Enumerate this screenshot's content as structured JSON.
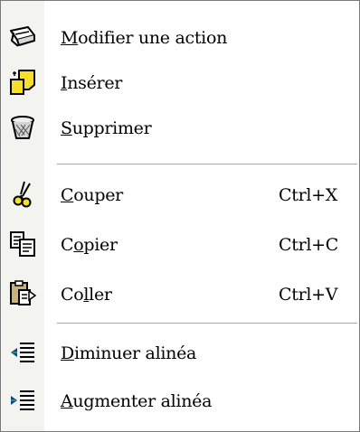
{
  "menu": {
    "items": [
      {
        "pre": "",
        "key": "M",
        "post": "odifier une action",
        "shortcut": "",
        "icon": "edit-action-icon"
      },
      {
        "pre": "",
        "key": "I",
        "post": "nsérer",
        "shortcut": "",
        "icon": "insert-icon"
      },
      {
        "pre": "",
        "key": "S",
        "post": "upprimer",
        "shortcut": "",
        "icon": "trash-icon"
      },
      {
        "pre": "",
        "key": "C",
        "post": "ouper",
        "shortcut": "Ctrl+X",
        "icon": "scissors-icon"
      },
      {
        "pre": "C",
        "key": "o",
        "post": "pier",
        "shortcut": "Ctrl+C",
        "icon": "copy-icon"
      },
      {
        "pre": "Co",
        "key": "l",
        "post": "ler",
        "shortcut": "Ctrl+V",
        "icon": "paste-icon"
      },
      {
        "pre": "",
        "key": "D",
        "post": "iminuer alinéa",
        "shortcut": "",
        "icon": "decrease-indent-icon"
      },
      {
        "pre": "",
        "key": "A",
        "post": "ugmenter alinéa",
        "shortcut": "",
        "icon": "increase-indent-icon"
      }
    ]
  },
  "colors": {
    "menu_background": "#ffffff",
    "icon_gutter": "#f3f3f0",
    "separator": "#a8a8a8",
    "border": "#7a7a7a",
    "folder_yellow": "#f7df29",
    "indent_blue": "#1a3a9a",
    "indent_green": "#1aa04a"
  }
}
